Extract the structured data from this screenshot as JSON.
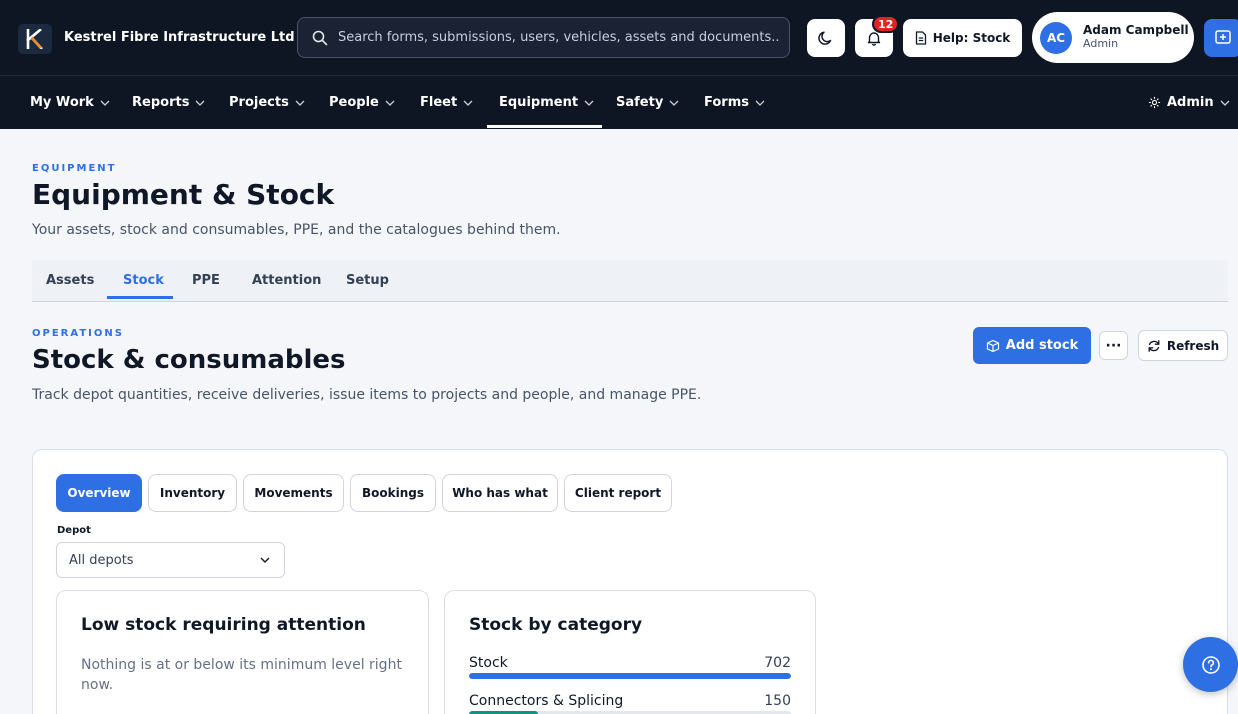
{
  "app": {
    "logo_letter": "K",
    "company": "Kestrel Fibre Infrastructure Ltd",
    "search_placeholder": "Search forms, submissions, users, vehicles, assets and documents..",
    "notifications_count": "12",
    "help_label": "Help: Stock",
    "user": {
      "initials": "AC",
      "name": "Adam Campbell",
      "role": "Admin"
    }
  },
  "nav": {
    "items": [
      {
        "label": "My Work"
      },
      {
        "label": "Reports"
      },
      {
        "label": "Projects"
      },
      {
        "label": "People"
      },
      {
        "label": "Fleet"
      },
      {
        "label": "Equipment",
        "active": true
      },
      {
        "label": "Safety"
      },
      {
        "label": "Forms"
      }
    ],
    "admin_label": "Admin"
  },
  "page": {
    "eyebrow": "EQUIPMENT",
    "title": "Equipment & Stock",
    "subtitle": "Your assets, stock and consumables, PPE, and the catalogues behind them.",
    "tabs": [
      {
        "label": "Assets"
      },
      {
        "label": "Stock",
        "active": true
      },
      {
        "label": "PPE"
      },
      {
        "label": "Attention"
      },
      {
        "label": "Setup"
      }
    ]
  },
  "section": {
    "eyebrow": "OPERATIONS",
    "title": "Stock & consumables",
    "subtitle": "Track depot quantities, receive deliveries, issue items to projects and people, and manage PPE.",
    "add_label": "Add stock",
    "more_label": "···",
    "refresh_label": "Refresh"
  },
  "card": {
    "tabs": [
      {
        "label": "Overview",
        "active": true
      },
      {
        "label": "Inventory"
      },
      {
        "label": "Movements"
      },
      {
        "label": "Bookings"
      },
      {
        "label": "Who has what"
      },
      {
        "label": "Client report"
      }
    ],
    "depot": {
      "label": "Depot",
      "value": "All depots"
    },
    "low_stock": {
      "title": "Low stock requiring attention",
      "empty_text": "Nothing is at or below its minimum level right now."
    },
    "by_category": {
      "title": "Stock by category",
      "items": [
        {
          "name": "Stock",
          "value": "702",
          "fraction": 1.0,
          "color": "#2f6fe4"
        },
        {
          "name": "Connectors & Splicing",
          "value": "150",
          "fraction": 0.214,
          "color": "#0e9384"
        }
      ]
    }
  },
  "colors": {
    "primary": "#2f6fe4",
    "topbar": "#0e1523",
    "badge": "#e02424"
  }
}
